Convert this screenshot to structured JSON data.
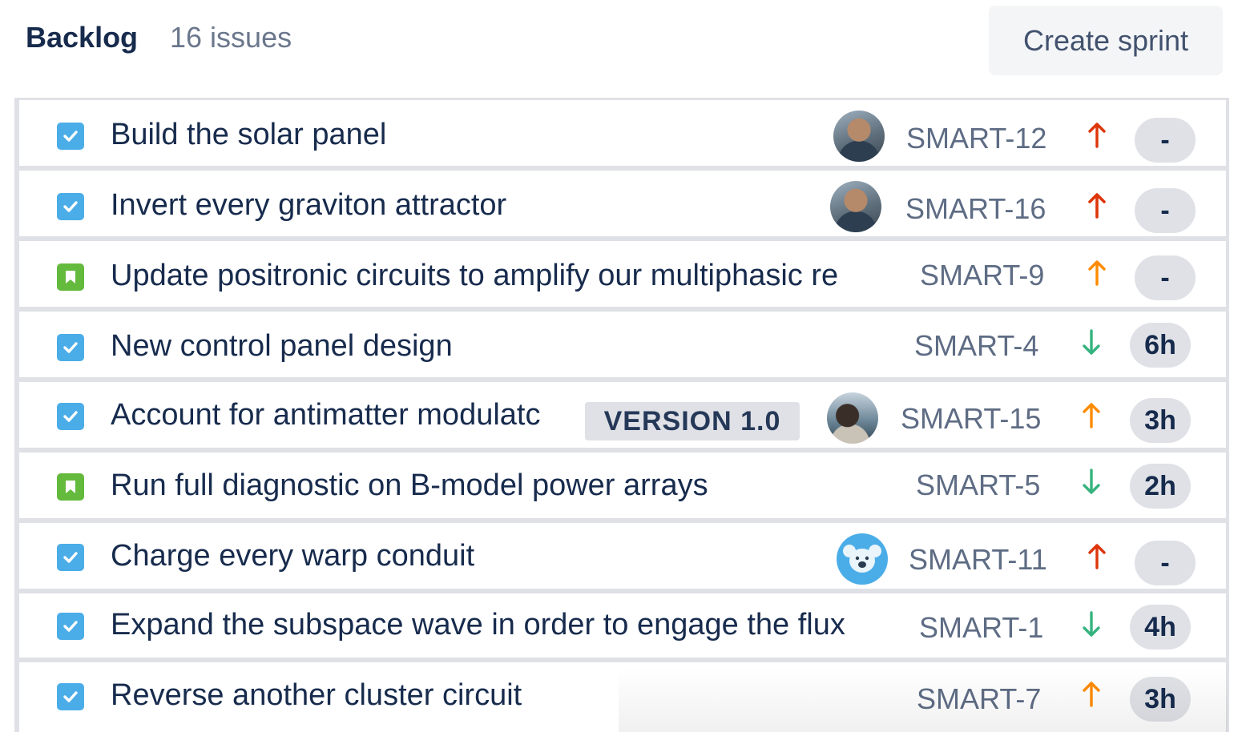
{
  "header": {
    "title": "Backlog",
    "count": "16 issues",
    "create_sprint_label": "Create sprint"
  },
  "issues": [
    {
      "type": "task",
      "summary": "Build the solar panel",
      "key": "SMART-12",
      "priority": "high",
      "priority_icon": "arrow-up-icon",
      "priority_color": "#de350b",
      "estimate": "-",
      "avatar": "person1"
    },
    {
      "type": "task",
      "summary": "Invert every graviton attractor",
      "key": "SMART-16",
      "priority": "highest",
      "priority_icon": "arrow-up-icon",
      "priority_color": "#de350b",
      "estimate": "-",
      "avatar": "person1"
    },
    {
      "type": "story",
      "summary": "Update positronic circuits to amplify our multiphasic re",
      "key": "SMART-9",
      "priority": "medium",
      "priority_icon": "arrow-up-icon",
      "priority_color": "#ff8b00",
      "estimate": "-",
      "avatar": null
    },
    {
      "type": "task",
      "summary": "New control panel design",
      "key": "SMART-4",
      "priority": "low",
      "priority_icon": "arrow-down-icon",
      "priority_color": "#36b37e",
      "estimate": "6h",
      "avatar": null
    },
    {
      "type": "task",
      "summary": "Account for antimatter modulatc",
      "version": "VERSION 1.0",
      "key": "SMART-15",
      "priority": "medium",
      "priority_icon": "arrow-up-icon",
      "priority_color": "#ff8b00",
      "estimate": "3h",
      "avatar": "person2"
    },
    {
      "type": "story",
      "summary": "Run full diagnostic on B-model power arrays",
      "key": "SMART-5",
      "priority": "low",
      "priority_icon": "arrow-down-icon",
      "priority_color": "#36b37e",
      "estimate": "2h",
      "avatar": null
    },
    {
      "type": "task",
      "summary": "Charge every warp conduit",
      "key": "SMART-11",
      "priority": "high",
      "priority_icon": "arrow-up-icon",
      "priority_color": "#de350b",
      "estimate": "-",
      "avatar": "koala"
    },
    {
      "type": "task",
      "summary": "Expand the subspace wave in order to engage the flux",
      "key": "SMART-1",
      "priority": "low",
      "priority_icon": "arrow-down-icon",
      "priority_color": "#36b37e",
      "estimate": "4h",
      "avatar": null
    },
    {
      "type": "task",
      "summary": "Reverse another cluster circuit",
      "key": "SMART-7",
      "priority": "medium",
      "priority_icon": "arrow-up-icon",
      "priority_color": "#ff8b00",
      "estimate": "3h",
      "avatar": null
    }
  ]
}
